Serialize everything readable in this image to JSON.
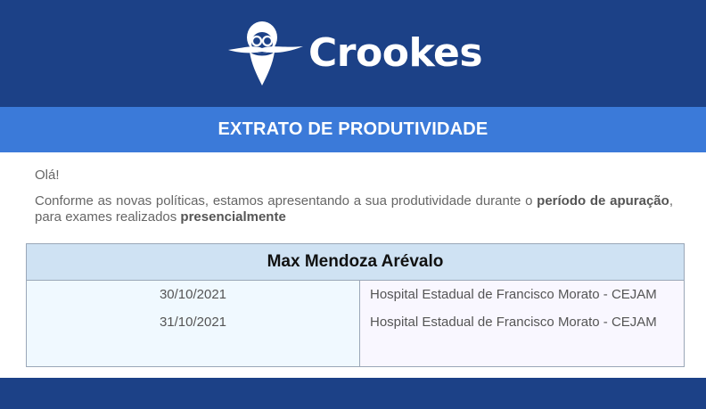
{
  "header": {
    "brand": "Crookes",
    "logo_icon": "bearded-scientist-logo-icon",
    "background": "#1c4187"
  },
  "title_bar": {
    "title": "EXTRATO DE PRODUTIVIDADE",
    "background": "#3b7ad9"
  },
  "message": {
    "greeting": "Olá!",
    "intro_part1": "Conforme as novas políticas, estamos apresentando a sua produtividade durante o ",
    "intro_bold1": "período de apuração",
    "intro_part2": ", para exames realizados ",
    "intro_bold2": "presencialmente"
  },
  "table": {
    "header": "Max Mendoza Arévalo",
    "header_background": "#cfe2f3",
    "rows": [
      {
        "date": "30/10/2021",
        "hospital": "Hospital Estadual de Francisco Morato - CEJAM"
      },
      {
        "date": "31/10/2021",
        "hospital": "Hospital Estadual de Francisco Morato - CEJAM"
      }
    ]
  },
  "footer": {
    "background": "#1c4187"
  }
}
